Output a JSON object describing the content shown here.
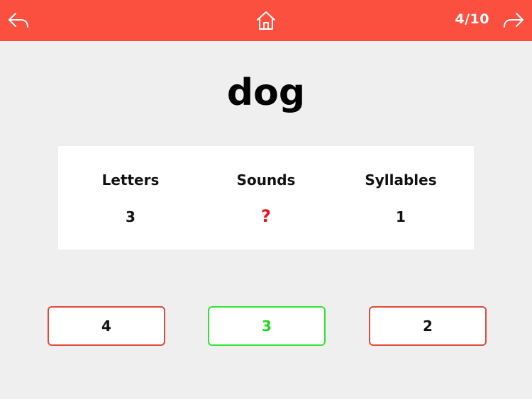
{
  "header": {
    "progress": "4/10",
    "accent_color": "#fb503f",
    "back_icon": "back-arrow-icon",
    "home_icon": "home-icon",
    "forward_icon": "forward-arrow-icon"
  },
  "word": "dog",
  "stats": [
    {
      "label": "Letters",
      "value": "3"
    },
    {
      "label": "Sounds",
      "value": "?"
    },
    {
      "label": "Syllables",
      "value": "1"
    }
  ],
  "answers": [
    {
      "label": "4",
      "state": "incorrect"
    },
    {
      "label": "3",
      "state": "correct"
    },
    {
      "label": "2",
      "state": "incorrect"
    }
  ],
  "colors": {
    "correct": "#22d422",
    "incorrect_border": "#e0493c",
    "question_mark": "#e8141b"
  }
}
